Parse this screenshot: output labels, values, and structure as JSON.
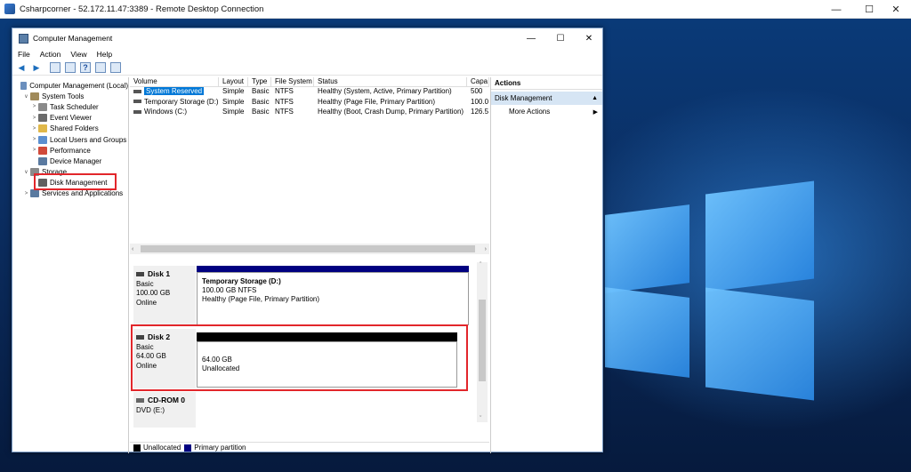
{
  "rdp": {
    "title": "Csharpcorner - 52.172.11.47:3389 - Remote Desktop Connection",
    "min": "—",
    "max": "☐",
    "close": "✕"
  },
  "mmc": {
    "title": "Computer Management",
    "min": "—",
    "max": "☐",
    "close": "✕"
  },
  "menu": [
    "File",
    "Action",
    "View",
    "Help"
  ],
  "tree": [
    {
      "label": "Computer Management (Local)",
      "arrow": "",
      "icon": "computer-management-icon",
      "color": "#6b8fbd",
      "indent": 0
    },
    {
      "label": "System Tools",
      "arrow": "∨",
      "icon": "tools-icon",
      "color": "#a08a5a",
      "indent": 1
    },
    {
      "label": "Task Scheduler",
      "arrow": ">",
      "icon": "clock-icon",
      "color": "#8a8a8a",
      "indent": 2
    },
    {
      "label": "Event Viewer",
      "arrow": ">",
      "icon": "event-viewer-icon",
      "color": "#6a6a6a",
      "indent": 2
    },
    {
      "label": "Shared Folders",
      "arrow": ">",
      "icon": "folder-icon",
      "color": "#e0b84a",
      "indent": 2
    },
    {
      "label": "Local Users and Groups",
      "arrow": ">",
      "icon": "users-icon",
      "color": "#5b8fd0",
      "indent": 2
    },
    {
      "label": "Performance",
      "arrow": ">",
      "icon": "performance-icon",
      "color": "#d04a3a",
      "indent": 2
    },
    {
      "label": "Device Manager",
      "arrow": "",
      "icon": "device-manager-icon",
      "color": "#5a7aa0",
      "indent": 2
    },
    {
      "label": "Storage",
      "arrow": "∨",
      "icon": "storage-icon",
      "color": "#8a8a8a",
      "indent": 1
    },
    {
      "label": "Disk Management",
      "arrow": "",
      "icon": "disk-icon",
      "color": "#606060",
      "indent": 2
    },
    {
      "label": "Services and Applications",
      "arrow": ">",
      "icon": "services-icon",
      "color": "#5a7aa0",
      "indent": 1
    }
  ],
  "volumes": {
    "headers": [
      "Volume",
      "Layout",
      "Type",
      "File System",
      "Status",
      "Capa"
    ],
    "rows": [
      [
        "System Reserved",
        "Simple",
        "Basic",
        "NTFS",
        "Healthy (System, Active, Primary Partition)",
        "500"
      ],
      [
        "Temporary Storage (D:)",
        "Simple",
        "Basic",
        "NTFS",
        "Healthy (Page File, Primary Partition)",
        "100.0"
      ],
      [
        "Windows (C:)",
        "Simple",
        "Basic",
        "NTFS",
        "Healthy (Boot, Crash Dump, Primary Partition)",
        "126.5"
      ]
    ]
  },
  "disks": {
    "disk1": {
      "name": "Disk 1",
      "type": "Basic",
      "size": "100.00 GB",
      "status": "Online",
      "part_name": "Temporary Storage  (D:)",
      "part_size": "100.00 GB NTFS",
      "part_status": "Healthy (Page File, Primary Partition)"
    },
    "disk2": {
      "name": "Disk 2",
      "type": "Basic",
      "size": "64.00 GB",
      "status": "Online",
      "part_size": "64.00 GB",
      "part_status": "Unallocated"
    },
    "cdrom": {
      "name": "CD-ROM 0",
      "type": "DVD (E:)"
    }
  },
  "legend": {
    "unallocated": "Unallocated",
    "primary": "Primary partition",
    "unallocated_color": "#000000",
    "primary_color": "#000080"
  },
  "actions": {
    "title": "Actions",
    "section": "Disk Management",
    "more": "More Actions"
  },
  "colors": {
    "highlight": "#e2262b",
    "selection": "#0078d7"
  }
}
